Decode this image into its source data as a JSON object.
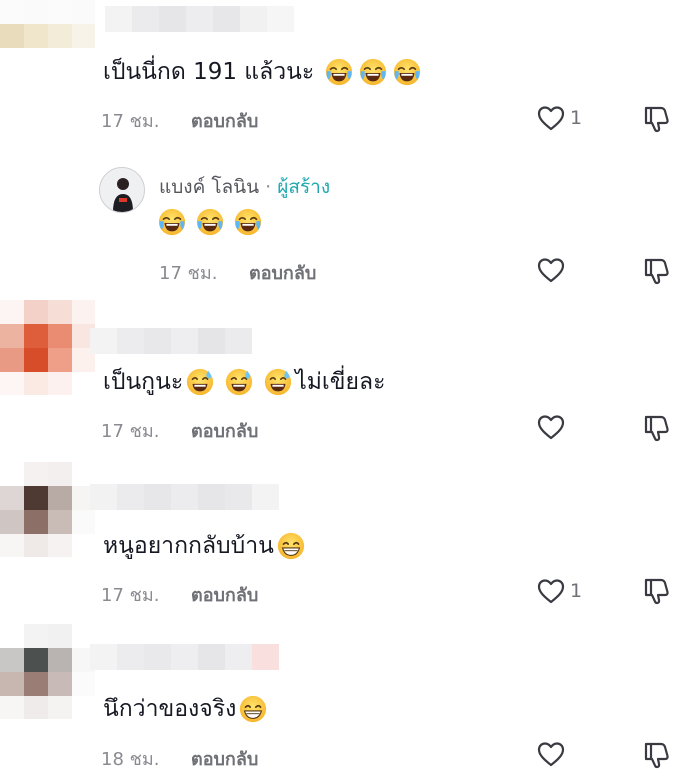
{
  "comments": [
    {
      "text": "เป็นนี่กด 191 แล้วนะ",
      "emoji": "face-with-tears-of-joy",
      "emoji_count": 3,
      "time": "17 ชม.",
      "reply": "ตอบกลับ",
      "likes": "1"
    },
    {
      "text": "เป็นกูนะ",
      "text_after": "ไม่เขี่ยละ",
      "emoji": "grinning-sweat",
      "emoji_count": 3,
      "time": "17 ชม.",
      "reply": "ตอบกลับ",
      "likes": ""
    },
    {
      "text": "หนูอยากกลับบ้าน",
      "emoji": "grinning-face",
      "emoji_count": 1,
      "time": "17 ชม.",
      "reply": "ตอบกลับ",
      "likes": "1"
    },
    {
      "text": "นึกว่าของจริง",
      "emoji": "grinning-face",
      "emoji_count": 1,
      "time": "18 ชม.",
      "reply": "ตอบกลับ",
      "likes": ""
    }
  ],
  "creator_reply": {
    "name": "แบงค์ โลนิน",
    "separator": "·",
    "tag": "ผู้สร้าง",
    "emoji": "face-with-tears-of-joy",
    "emoji_count": 3,
    "time": "17 ชม.",
    "reply": "ตอบกลับ",
    "likes": ""
  },
  "colors": {
    "creator_tag": "#1fa9b0",
    "meta": "#8a8b91"
  }
}
